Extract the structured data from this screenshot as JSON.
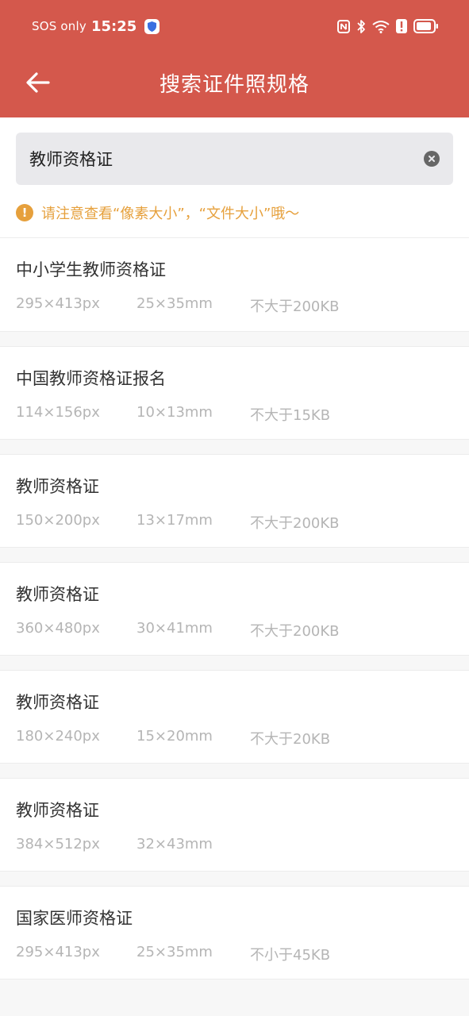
{
  "status_bar": {
    "carrier": "SOS only",
    "time": "15:25"
  },
  "nav": {
    "title": "搜索证件照规格"
  },
  "search": {
    "value": "教师资格证",
    "placeholder": ""
  },
  "notice": {
    "icon": "!",
    "text": "请注意查看“像素大小”，“文件大小”哦～"
  },
  "colors": {
    "brand": "#d4584c",
    "warning": "#e6a03c"
  },
  "results": [
    {
      "title": "中小学生教师资格证",
      "pixel_size": "295×413px",
      "physical_size": "25×35mm",
      "file_size": "不大于200KB"
    },
    {
      "title": "中国教师资格证报名",
      "pixel_size": "114×156px",
      "physical_size": "10×13mm",
      "file_size": "不大于15KB"
    },
    {
      "title": "教师资格证",
      "pixel_size": "150×200px",
      "physical_size": "13×17mm",
      "file_size": "不大于200KB"
    },
    {
      "title": "教师资格证",
      "pixel_size": "360×480px",
      "physical_size": "30×41mm",
      "file_size": "不大于200KB"
    },
    {
      "title": "教师资格证",
      "pixel_size": "180×240px",
      "physical_size": "15×20mm",
      "file_size": "不大于20KB"
    },
    {
      "title": "教师资格证",
      "pixel_size": "384×512px",
      "physical_size": "32×43mm",
      "file_size": ""
    },
    {
      "title": "国家医师资格证",
      "pixel_size": "295×413px",
      "physical_size": "25×35mm",
      "file_size": "不小于45KB"
    }
  ]
}
